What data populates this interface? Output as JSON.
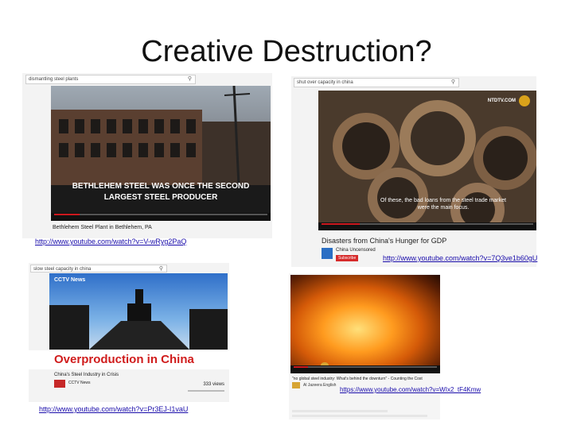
{
  "slide": {
    "title": "Creative Destruction?"
  },
  "video1": {
    "search_text": "dismantling steel plants",
    "caption_line1": "BETHLEHEM STEEL WAS ONCE THE SECOND",
    "caption_line2": "LARGEST STEEL PRODUCER",
    "video_title": "Bethlehem Steel Plant in Bethlehem, PA",
    "progress": 0.12,
    "url": "http://www.youtube.com/watch?v=V-wRyg2PaQ"
  },
  "video2": {
    "search_text": "shut over capacity in china",
    "channel_logo": "NTDTV.COM",
    "caption_line1": "Of these, the bad loans from the steel trade market",
    "caption_line2": "were the main focus.",
    "video_title": "Disasters from China's Hunger for GDP",
    "channel_name": "China Uncensored",
    "subscribe_label": "Subscribe",
    "progress": 0.18,
    "url": "http://www.youtube.com/watch?v=7Q3ve1b60gU"
  },
  "video3": {
    "search_text": "slow steel capacity in china",
    "channel_logo": "CCTV News",
    "overlay_label": "Overproduction in China",
    "video_title": "China's Steel Industry in Crisis",
    "channel_name": "CCTV News",
    "views": "333 views",
    "url": "http://www.youtube.com/watch?v=Pr3EJ-I1vaU"
  },
  "video4": {
    "video_title": "\"no global steel industry: What's behind the downturn\" - Counting the Cost",
    "channel_name": "Al Jazeera English",
    "url": "https://www.youtube.com/watch?v=WIx2_tF4Kmw",
    "progress": 0.1
  }
}
